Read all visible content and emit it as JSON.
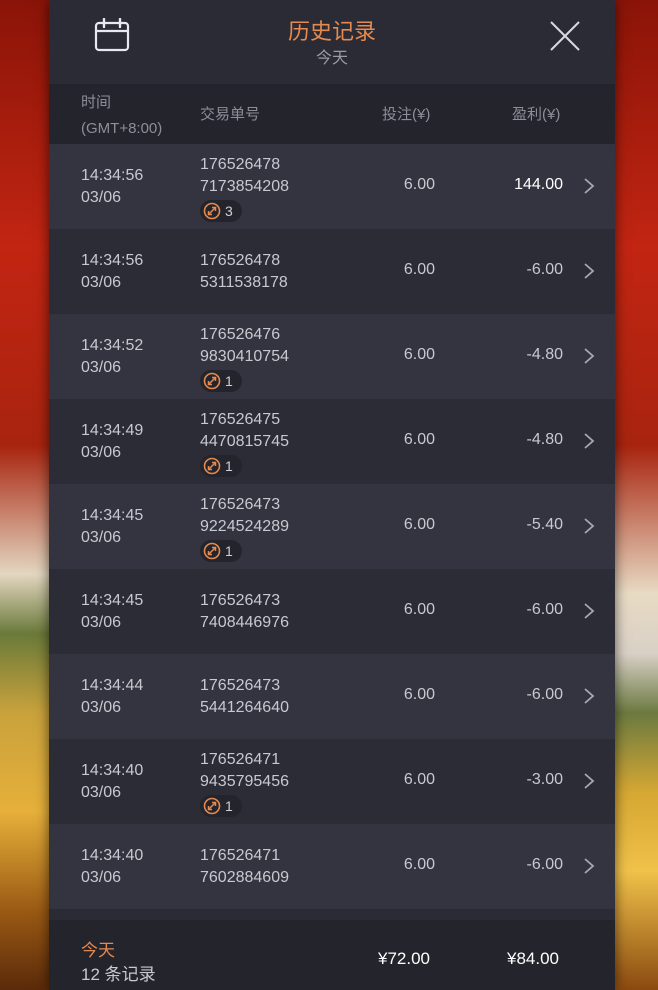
{
  "header": {
    "title": "历史记录",
    "subtitle": "今天",
    "calendar_icon": "calendar-icon",
    "close_icon": "close-icon"
  },
  "columns": {
    "time_line1": "时间",
    "time_line2": "(GMT+8:00)",
    "order": "交易单号",
    "bet": "投注(¥)",
    "profit": "盈利(¥)"
  },
  "rows": [
    {
      "time": "14:34:56",
      "date": "03/06",
      "order1": "176526478",
      "order2": "7173854208",
      "badge": "3",
      "bet": "6.00",
      "profit": "144.00",
      "win": true
    },
    {
      "time": "14:34:56",
      "date": "03/06",
      "order1": "176526478",
      "order2": "5311538178",
      "badge": "",
      "bet": "6.00",
      "profit": "-6.00",
      "win": false
    },
    {
      "time": "14:34:52",
      "date": "03/06",
      "order1": "176526476",
      "order2": "9830410754",
      "badge": "1",
      "bet": "6.00",
      "profit": "-4.80",
      "win": false
    },
    {
      "time": "14:34:49",
      "date": "03/06",
      "order1": "176526475",
      "order2": "4470815745",
      "badge": "1",
      "bet": "6.00",
      "profit": "-4.80",
      "win": false
    },
    {
      "time": "14:34:45",
      "date": "03/06",
      "order1": "176526473",
      "order2": "9224524289",
      "badge": "1",
      "bet": "6.00",
      "profit": "-5.40",
      "win": false
    },
    {
      "time": "14:34:45",
      "date": "03/06",
      "order1": "176526473",
      "order2": "7408446976",
      "badge": "",
      "bet": "6.00",
      "profit": "-6.00",
      "win": false
    },
    {
      "time": "14:34:44",
      "date": "03/06",
      "order1": "176526473",
      "order2": "5441264640",
      "badge": "",
      "bet": "6.00",
      "profit": "-6.00",
      "win": false
    },
    {
      "time": "14:34:40",
      "date": "03/06",
      "order1": "176526471",
      "order2": "9435795456",
      "badge": "1",
      "bet": "6.00",
      "profit": "-3.00",
      "win": false
    },
    {
      "time": "14:34:40",
      "date": "03/06",
      "order1": "176526471",
      "order2": "7602884609",
      "badge": "",
      "bet": "6.00",
      "profit": "-6.00",
      "win": false
    }
  ],
  "footer": {
    "label": "今天",
    "count": "12 条记录",
    "total_bet": "¥72.00",
    "total_profit": "¥84.00"
  },
  "colors": {
    "accent": "#e4894f",
    "panel": "#2b2b35"
  }
}
